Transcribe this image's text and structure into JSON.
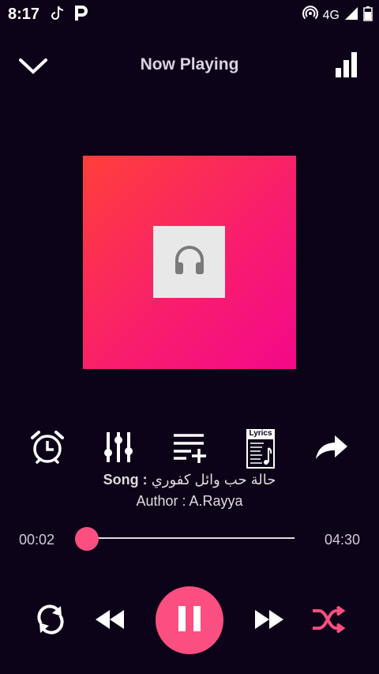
{
  "status_bar": {
    "time": "8:17",
    "network": "4G",
    "icons": [
      "tiktok-icon",
      "p-app-icon",
      "hotspot-icon",
      "signal-icon",
      "battery-icon"
    ]
  },
  "header": {
    "title": "Now Playing",
    "icons": [
      "chevron-down-icon",
      "queue-bars-icon"
    ]
  },
  "album_art": {
    "icon": "headphones-icon"
  },
  "tools": {
    "icons": [
      "alarm-clock-icon",
      "equalizer-icon",
      "add-to-playlist-icon",
      "lyrics-icon",
      "share-icon"
    ],
    "lyrics_label": "Lyrics"
  },
  "song": {
    "prefix": "Song :",
    "title": "حالة حب  وائل كفوري",
    "author_prefix": "Author :",
    "author": "A.Rayya"
  },
  "progress": {
    "current": "00:02",
    "duration": "04:30",
    "fraction": 0.007
  },
  "controls": {
    "icons": [
      "repeat-icon",
      "rewind-icon",
      "pause-icon",
      "fast-forward-icon",
      "shuffle-icon"
    ]
  },
  "colors": {
    "background": "#0d0318",
    "accent": "#fa4f80",
    "art_gradient_start": "#ff3f3a",
    "art_gradient_end": "#f4088a"
  }
}
